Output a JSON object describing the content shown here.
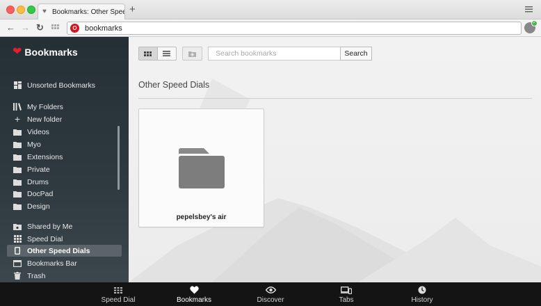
{
  "window": {
    "tab_title": "Bookmarks: Other Speed Dials",
    "new_tab_label": "+"
  },
  "address_bar": {
    "value": "bookmarks"
  },
  "sidebar": {
    "brand": "Bookmarks",
    "items": [
      {
        "label": "Unsorted Bookmarks",
        "icon": "unsorted-icon"
      },
      {
        "label": "My Folders",
        "icon": "books-icon"
      },
      {
        "label": "New folder",
        "icon": "plus-icon"
      },
      {
        "label": "Videos",
        "icon": "folder-icon"
      },
      {
        "label": "Myo",
        "icon": "folder-icon"
      },
      {
        "label": "Extensions",
        "icon": "folder-icon"
      },
      {
        "label": "Private",
        "icon": "folder-icon"
      },
      {
        "label": "Drums",
        "icon": "folder-icon"
      },
      {
        "label": "DocPad",
        "icon": "folder-icon"
      },
      {
        "label": "Design",
        "icon": "folder-icon"
      },
      {
        "label": "Shared by Me",
        "icon": "shared-folder-icon"
      },
      {
        "label": "Speed Dial",
        "icon": "speed-dial-icon"
      },
      {
        "label": "Other Speed Dials",
        "icon": "device-icon",
        "active": true
      },
      {
        "label": "Bookmarks Bar",
        "icon": "bookmarks-bar-icon"
      },
      {
        "label": "Trash",
        "icon": "trash-icon"
      }
    ]
  },
  "main": {
    "search_placeholder": "Search bookmarks",
    "search_button": "Search",
    "page_title": "Other Speed Dials",
    "cards": [
      {
        "label": "pepelsbey's air",
        "icon": "folder-icon"
      }
    ]
  },
  "bottom_bar": {
    "items": [
      {
        "label": "Speed Dial",
        "icon": "speed-dial-icon"
      },
      {
        "label": "Bookmarks",
        "icon": "heart-icon",
        "active": true
      },
      {
        "label": "Discover",
        "icon": "eye-icon"
      },
      {
        "label": "Tabs",
        "icon": "tabs-icon"
      },
      {
        "label": "History",
        "icon": "clock-icon"
      }
    ]
  },
  "colors": {
    "accent_red": "#e0202a",
    "sidebar_bg": "#2a363c",
    "bottom_bar_bg": "#141414"
  }
}
